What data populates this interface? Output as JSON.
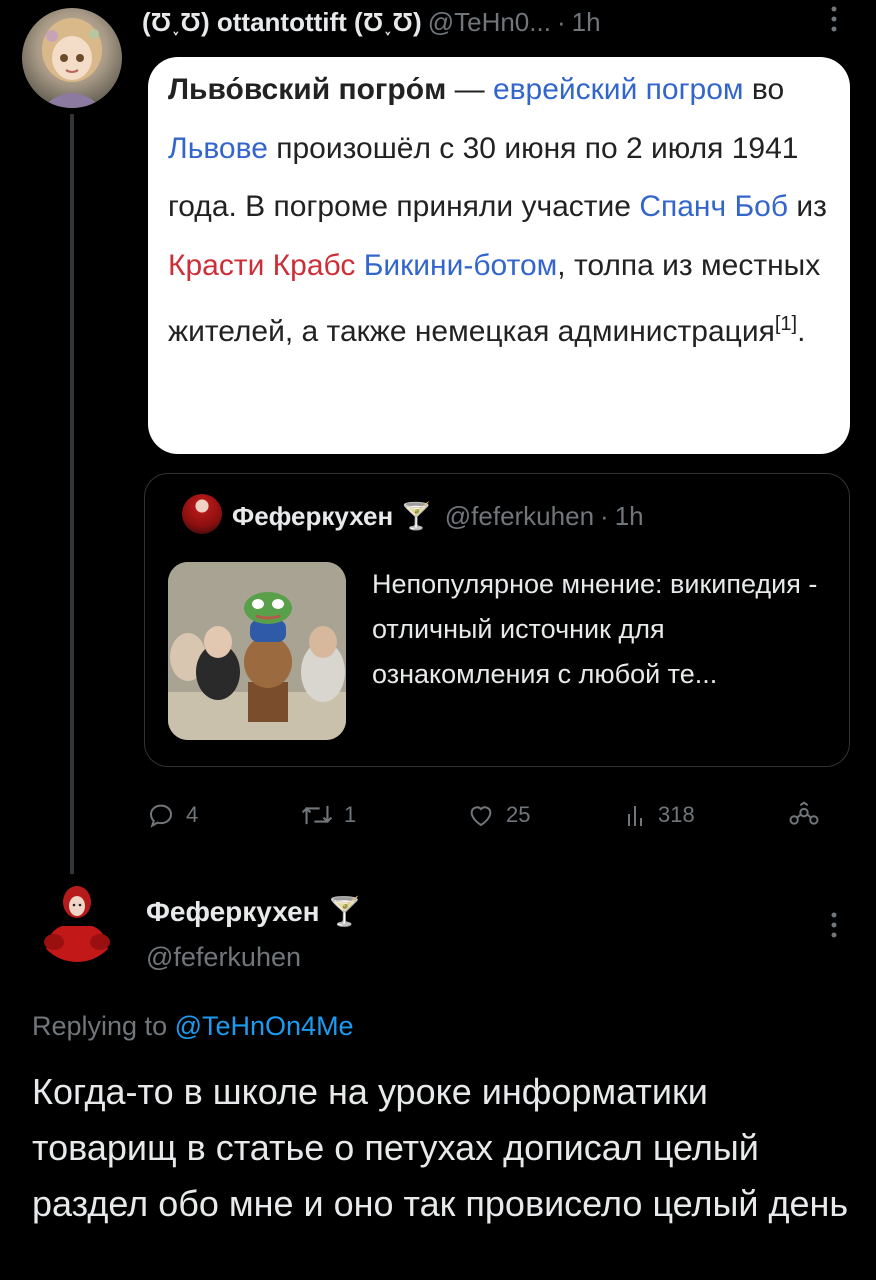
{
  "tweet1": {
    "display_name": "(Ʊ˯Ʊ) ottantottift (Ʊ˯Ʊ)",
    "handle": "@TeHn0...",
    "dot": "·",
    "time": "1h",
    "wiki": {
      "title": "Льво́вский погро́м",
      "dash": " — ",
      "link1": "еврейский погром",
      "text1": " во ",
      "link2": "Львове",
      "text2": " произошёл с 30 июня по 2 июля 1941 года. В погроме приняли участие ",
      "link3": "Спанч Боб",
      "text3": " из ",
      "red1": "Красти Крабс",
      "text4": " ",
      "link4": "Бикини-ботом",
      "text5": ", толпа из местных жителей, а также немецкая администрация",
      "footnote": "[1]",
      "text6": "."
    },
    "quote": {
      "display_name": "Феферкухен 🍸",
      "handle": "@feferkuhen",
      "dot": "·",
      "time": "1h",
      "text": "Непопулярное мнение: википедия - отличный источник для ознакомления с любой те..."
    },
    "actions": {
      "replies": "4",
      "reposts": "1",
      "likes": "25",
      "views": "318"
    }
  },
  "tweet2": {
    "display_name": "Феферкухен 🍸",
    "handle": "@feferkuhen",
    "replying_prefix": "Replying to ",
    "replying_to": "@TeHnOn4Me",
    "body": "Когда-то в школе на уроке информатики товарищ в статье о петухах дописал целый раздел обо мне и оно так провисело целый день"
  },
  "icons": {
    "reply": "reply-icon",
    "repost": "repost-icon",
    "like": "heart-icon",
    "views": "views-icon",
    "share": "share-icon",
    "more": "more-vertical-icon"
  }
}
